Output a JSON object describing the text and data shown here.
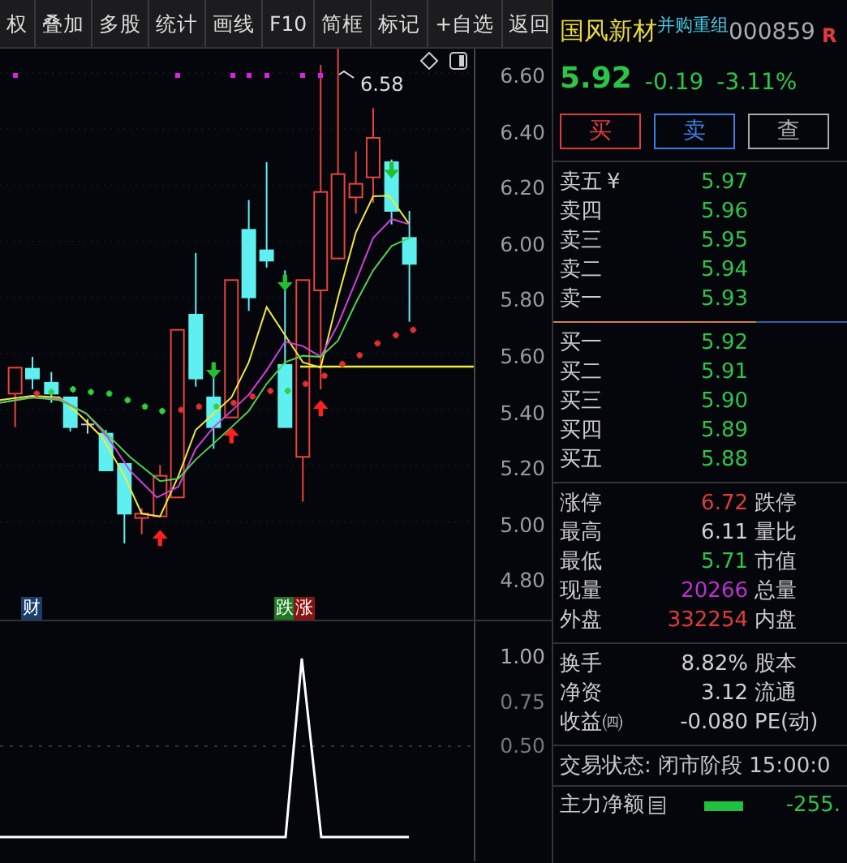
{
  "toolbar": [
    "权",
    "叠加",
    "多股",
    "统计",
    "画线",
    "F10",
    "简框",
    "标记",
    "+自选",
    "返回"
  ],
  "main_chart": {
    "price_marker": "6.58",
    "y_ticks": [
      "6.60",
      "6.40",
      "6.20",
      "6.00",
      "5.80",
      "5.60",
      "5.40",
      "5.20",
      "5.00",
      "4.80"
    ],
    "tags": [
      {
        "text": "财",
        "color": "#1b3d6e"
      },
      {
        "text": "跌",
        "color": "#1c7a22"
      },
      {
        "text": "涨",
        "color": "#8a1212"
      }
    ]
  },
  "lower_chart": {
    "y_ticks": [
      "1.00",
      "0.75",
      "0.50"
    ]
  },
  "quote": {
    "name": "国风新材",
    "tag": "并购重组",
    "code": "000859",
    "flag": "R",
    "price": "5.92",
    "change": "-0.19",
    "change_pct": "-3.11%",
    "buttons": [
      {
        "label": "买",
        "kind": "buy"
      },
      {
        "label": "卖",
        "kind": "sell"
      },
      {
        "label": "查",
        "kind": "query"
      }
    ]
  },
  "asks": [
    {
      "label": "卖五",
      "mark": "¥",
      "price": "5.97"
    },
    {
      "label": "卖四",
      "price": "5.96"
    },
    {
      "label": "卖三",
      "price": "5.95"
    },
    {
      "label": "卖二",
      "price": "5.94"
    },
    {
      "label": "卖一",
      "price": "5.93"
    }
  ],
  "bids": [
    {
      "label": "买一",
      "price": "5.92"
    },
    {
      "label": "买二",
      "price": "5.91"
    },
    {
      "label": "买三",
      "price": "5.90"
    },
    {
      "label": "买四",
      "price": "5.89"
    },
    {
      "label": "买五",
      "price": "5.88"
    }
  ],
  "stats": [
    {
      "label": "涨停",
      "value": "6.72",
      "color": "#e03c3c",
      "label2": "跌停"
    },
    {
      "label": "最高",
      "value": "6.11",
      "color": "#d0d0d0",
      "label2": "量比"
    },
    {
      "label": "最低",
      "value": "5.71",
      "color": "#2ec44a",
      "label2": "市值"
    },
    {
      "label": "现量",
      "value": "20266",
      "color": "#c030d0",
      "label2": "总量"
    },
    {
      "label": "外盘",
      "value": "332254",
      "color": "#e03c3c",
      "label2": "内盘"
    }
  ],
  "stats2": [
    {
      "label": "换手",
      "value": "8.82%",
      "label2": "股本"
    },
    {
      "label": "净资",
      "value": "3.12",
      "label2": "流通"
    },
    {
      "label": "收益㈣",
      "value": "-0.080",
      "label2": "PE(动)"
    }
  ],
  "status": "交易状态: 闭市阶段 15:00:0",
  "main_force": {
    "label": "主力净额",
    "value": "-255."
  }
}
